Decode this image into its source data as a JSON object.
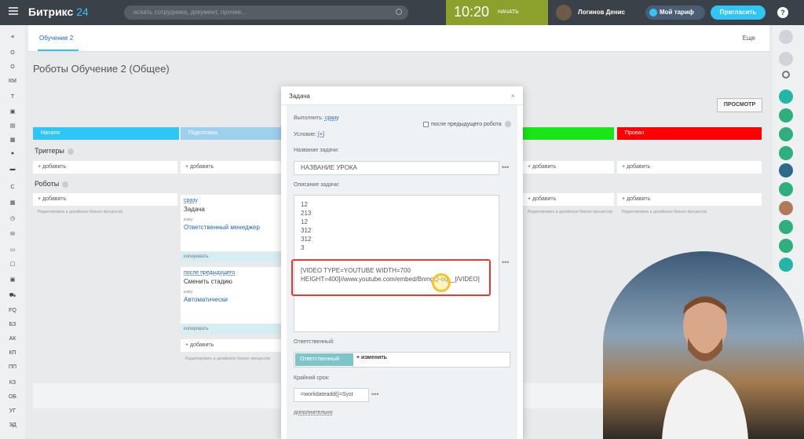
{
  "header": {
    "logo_brand": "Битрикс",
    "logo_num": "24",
    "search_placeholder": "искать сотрудника, документ, прочее...",
    "clock": "10:20",
    "clock_state": "НАЧАТЬ",
    "user_name": "Логинов Денис",
    "tariff_label": "Мой тариф",
    "invite_label": "Пригласить",
    "help": "?"
  },
  "left_sidebar": {
    "items": [
      "О",
      "О",
      "КМ",
      "Т",
      "С",
      "FQ",
      "БЗ",
      "АК",
      "КП",
      "ПП",
      "КЗ",
      "ОБ",
      "УГ",
      "ЭД"
    ]
  },
  "tabs": {
    "active": "Обучение 2",
    "more": "Еще"
  },
  "page": {
    "title": "Роботы Обучение 2 (Общее)",
    "preview": "ПРОСМОТР"
  },
  "stages": [
    {
      "name": "Начало",
      "color": "#2fc6f6"
    },
    {
      "name": "Подготовка",
      "color": "#9dcfef"
    },
    {
      "name": "",
      "color": "#19e519"
    },
    {
      "name": "Провал",
      "color": "#ff0000"
    }
  ],
  "sections": {
    "triggers": "Триггеры",
    "robots": "Роботы",
    "add": "+ добавить",
    "hint": "Редактировать в дизайнере бизнес-процессов"
  },
  "robot_cards": [
    {
      "link": "сразу",
      "title": "Задача",
      "who_label": "кому:",
      "who": "Ответственный менеджер",
      "copy": "копировать"
    },
    {
      "link": "после предыдущего",
      "title": "Сменить стадию",
      "who_label": "кому:",
      "who": "Автоматически",
      "copy": "копировать"
    }
  ],
  "modal": {
    "title": "Задача",
    "close": "×",
    "exec_label": "Выполнить:",
    "exec_value": "сразу",
    "after_prev": "после предыдущего робота",
    "condition_label": "Условие:",
    "condition_value": "[+]",
    "name_label": "Название задачи:",
    "name_value": "НАЗВАНИЕ УРОКА",
    "desc_label": "Описание задачи:",
    "desc_lines": [
      "12",
      "213",
      "12",
      "312",
      "312",
      "3"
    ],
    "desc_video_1": "[VIDEO TYPE=YOUTUBE WIDTH=700",
    "desc_video_2": "HEIGHT=400]//www.youtube.com/embed/BnmgQ-oq__[/VIDEO]",
    "responsible_label": "Ответственный:",
    "responsible_tag": "Ответственный",
    "change": "+ изменить",
    "deadline_label": "Крайний срок:",
    "deadline_value": "=workdateadd({=Syst",
    "additional": "дополнительно"
  },
  "colors": {
    "accent": "#2fc6f6",
    "header": "#3a4149",
    "clock_bg": "#8ba12c",
    "highlight": "#e53935"
  }
}
